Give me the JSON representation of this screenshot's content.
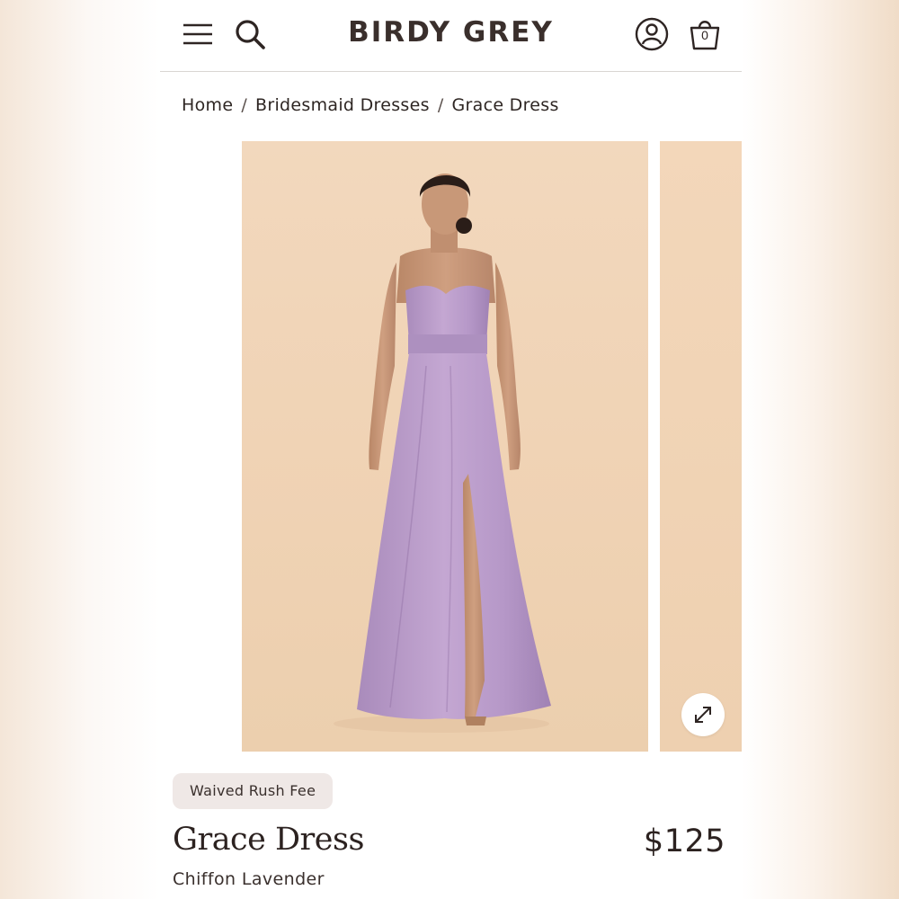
{
  "header": {
    "logo": "BIRDY GREY",
    "bag_count": "0",
    "icons": {
      "menu": "menu-icon",
      "search": "search-icon",
      "account": "account-icon",
      "bag": "shopping-bag-icon"
    }
  },
  "breadcrumb": {
    "items": [
      "Home",
      "Bridesmaid Dresses",
      "Grace Dress"
    ],
    "separator": "/"
  },
  "gallery": {
    "main_image": "model-lavender-strapless-gown-image",
    "expand_icon": "expand-icon"
  },
  "product": {
    "badge": "Waived Rush Fee",
    "name": "Grace Dress",
    "price": "$125",
    "variant": "Chiffon Lavender"
  },
  "colors": {
    "photo_background": "#f0d3b5",
    "dress": "#b99ac8",
    "text": "#2c2220",
    "badge_bg": "#efe8e6"
  }
}
